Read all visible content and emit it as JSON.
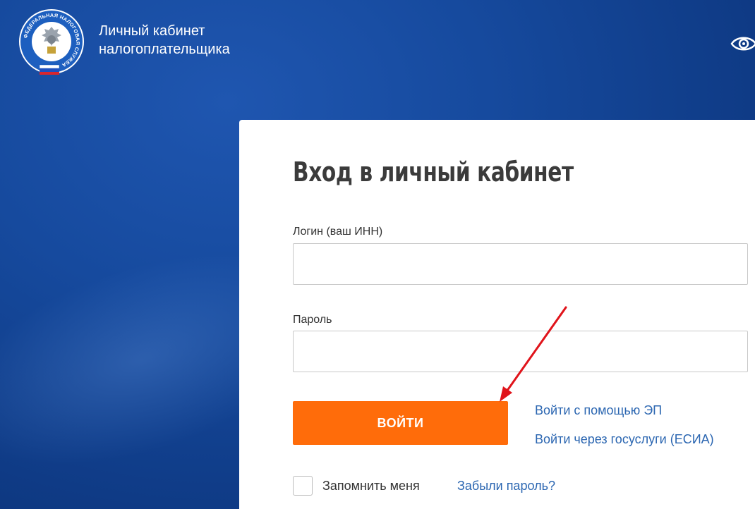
{
  "header": {
    "logo_text": "ФЕДЕРАЛЬНАЯ НАЛОГОВАЯ СЛУЖБА",
    "title_line1": "Личный кабинет",
    "title_line2": "налогоплательщика",
    "eye_icon": "eye-icon"
  },
  "login_form": {
    "heading": "Вход в личный кабинет",
    "login_label": "Логин (ваш ИНН)",
    "login_value": "",
    "password_label": "Пароль",
    "password_value": "",
    "submit_label": "ВОЙТИ",
    "ep_link": "Войти с помощью ЭП",
    "esia_link": "Войти через госуслуги (ЕСИА)",
    "remember_label": "Запомнить меня",
    "forgot_link": "Забыли пароль?"
  },
  "colors": {
    "accent_button": "#ff6c0a",
    "link": "#2b66b1",
    "background": "#164a9e",
    "annotation_arrow": "#e0131a"
  }
}
